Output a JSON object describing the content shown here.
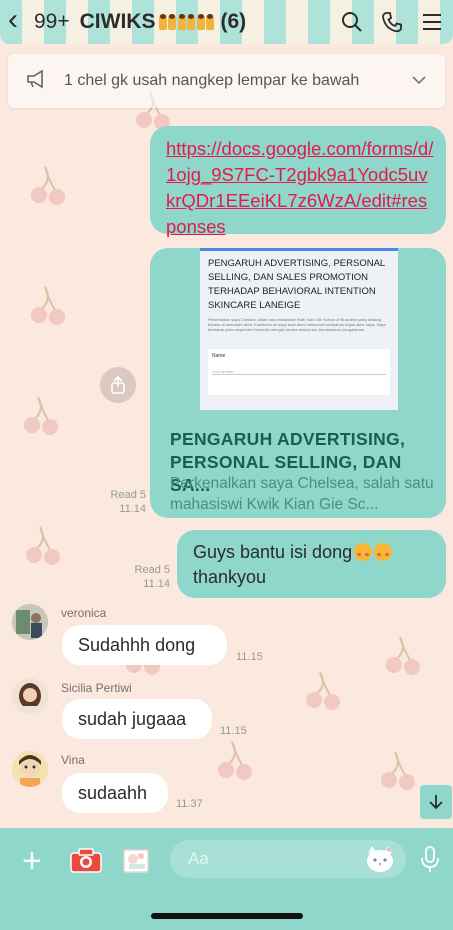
{
  "header": {
    "back_icon": "chevron-left-icon",
    "unread": "99+",
    "title": "CIWIKS",
    "member_count": "(6)"
  },
  "announcement": {
    "text": "1 chel gk usah nangkep lempar ke bawah"
  },
  "messages": {
    "link": "https://docs.google.com/forms/d/1ojg_9S7FC-T2gbk9a1Yodc5uvkrQDr1EEeiKL7z6WzA/edit#responses",
    "preview": {
      "doc_title": "PENGARUH ADVERTISING, PERSONAL SELLING, DAN SALES PROMOTION TERHADAP BEHAVIORAL INTENTION SKINCARE LANEIGE",
      "doc_body": "Perkenalkan saya Chelsea, salah satu mahasiswi Kwik Kian Gie School of Business yang sedang berada di semester akhir. Kuesioner ini saya buat demi memenuhi tambahan tugas akhir saya. Saya berharap para responden bersedia mengisi secara akurat dan berdasarkan pengalaman.",
      "field_label": "Name",
      "field_placeholder": "Your answer",
      "title": "PENGARUH ADVERTISING, PERSONAL SELLING, DAN SA...",
      "desc": "Perkenalkan saya Chelsea, salah satu mahasiswi Kwik Kian Gie Sc..."
    },
    "read1": "Read 5",
    "time1": "11.14",
    "mine_text_line1": "Guys bantu isi dong",
    "mine_text_line2": "thankyou",
    "read2": "Read 5",
    "time2": "11.14",
    "others": [
      {
        "sender": "veronica",
        "text": "Sudahhh dong",
        "time": "11.15"
      },
      {
        "sender": "Sicilia Pertiwi",
        "text": "sudah jugaaa",
        "time": "11.15"
      },
      {
        "sender": "Vina",
        "text": "sudaahh",
        "time": "11.37"
      }
    ]
  },
  "input": {
    "placeholder": "Aa"
  },
  "colors": {
    "accent": "#8fd6cb",
    "link": "#e4194c",
    "background": "#fbe9df"
  }
}
